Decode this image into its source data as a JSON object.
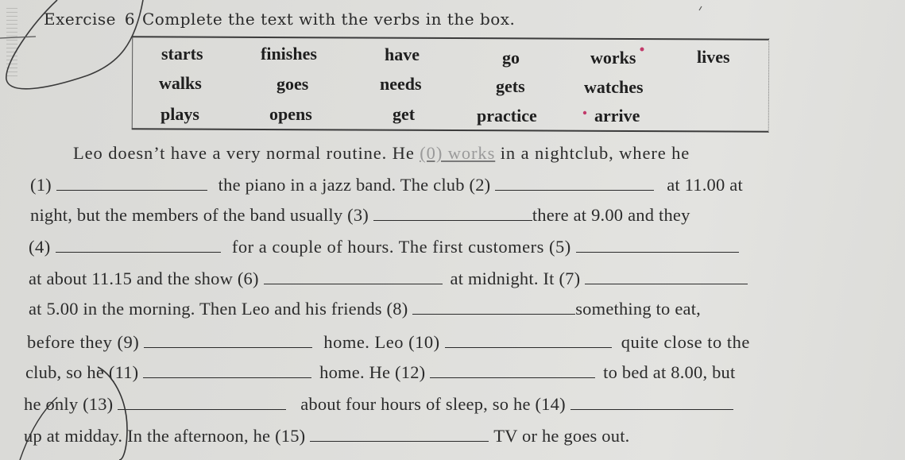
{
  "exercise": {
    "label": "Exercise",
    "number": "6",
    "instruction": "Complete the text with the verbs in the box."
  },
  "word_box": {
    "rows": [
      [
        "starts",
        "finishes",
        "have",
        "go",
        "works",
        "lives"
      ],
      [
        "walks",
        "goes",
        "needs",
        "gets",
        "watches"
      ],
      [
        "plays",
        "opens",
        "get",
        "practice",
        "arrive"
      ]
    ]
  },
  "passage": {
    "lines": [
      {
        "segments": [
          "Leo doesn’t have a very normal routine. He ",
          "(0) works",
          " in a nightclub, where he"
        ]
      },
      {
        "segments": [
          "(1) ",
          "the piano in a jazz band. The club (2) ",
          "at 11.00 at"
        ]
      },
      {
        "segments": [
          "night, but the members of the band usually (3) ",
          "there at 9.00 and they"
        ]
      },
      {
        "segments": [
          "(4) ",
          "for a couple of hours. The first customers (5) "
        ]
      },
      {
        "segments": [
          "at about 11.15 and the show (6) ",
          "at midnight. It (7) "
        ]
      },
      {
        "segments": [
          "at 5.00 in the morning. Then Leo and his friends (8) ",
          "something to eat,"
        ]
      },
      {
        "segments": [
          "before they (9) ",
          "home. Leo (10) ",
          "quite close to the"
        ]
      },
      {
        "segments": [
          "club, so he (11) ",
          "home. He (12) ",
          "to bed at 8.00, but"
        ]
      },
      {
        "segments": [
          "he only (13) ",
          "about four hours of sleep, so he (14) "
        ]
      },
      {
        "segments": [
          "up at midday. In the afternoon, he (15) ",
          "TV or he goes out."
        ]
      }
    ],
    "example_answer": "works"
  }
}
